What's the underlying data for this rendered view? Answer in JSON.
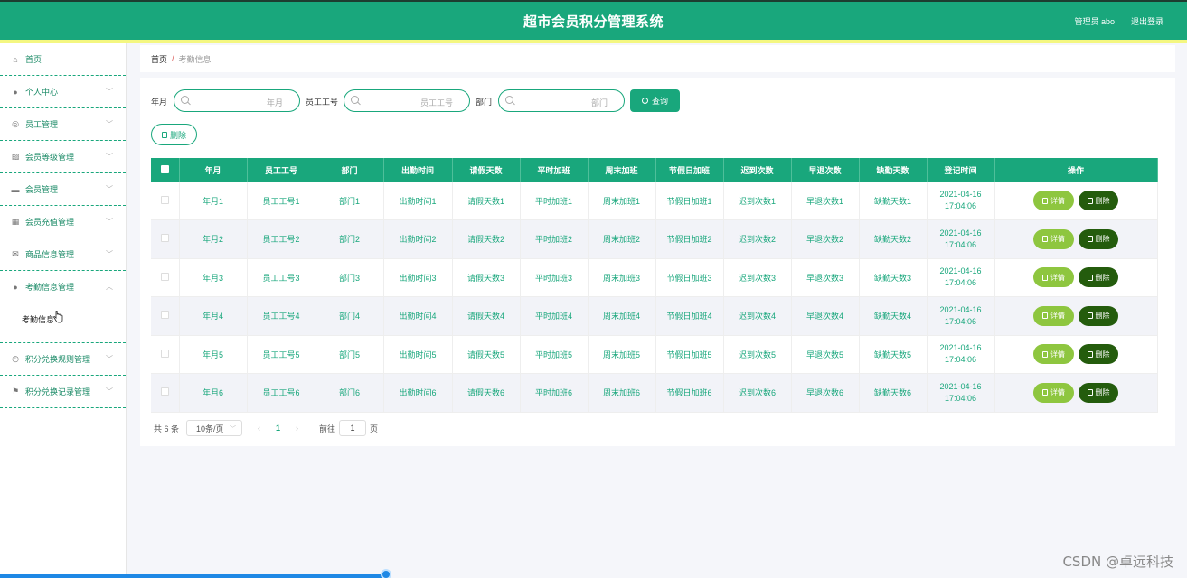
{
  "header": {
    "title": "超市会员积分管理系统",
    "admin": "管理员 abo",
    "logout": "退出登录"
  },
  "sidebar": {
    "items": [
      {
        "label": "首页",
        "icon": "home-icon",
        "chevron": false
      },
      {
        "label": "个人中心",
        "icon": "user-icon",
        "chevron": true
      },
      {
        "label": "员工管理",
        "icon": "circle-icon",
        "chevron": true
      },
      {
        "label": "会员等级管理",
        "icon": "chart-icon",
        "chevron": true
      },
      {
        "label": "会员管理",
        "icon": "chat-icon",
        "chevron": true
      },
      {
        "label": "会员充值管理",
        "icon": "grid-icon",
        "chevron": true
      },
      {
        "label": "商品信息管理",
        "icon": "mail-icon",
        "chevron": true
      },
      {
        "label": "考勤信息管理",
        "icon": "person-icon",
        "chevron": true,
        "expanded": true
      }
    ],
    "sub_item": "考勤信息",
    "items_after": [
      {
        "label": "积分兑换规则管理",
        "icon": "clock-icon",
        "chevron": true
      },
      {
        "label": "积分兑换记录管理",
        "icon": "flag-icon",
        "chevron": true
      }
    ]
  },
  "breadcrumb": {
    "home": "首页",
    "separator": "/",
    "current": "考勤信息"
  },
  "search": {
    "label_1": "年月",
    "placeholder_1": "年月",
    "label_2": "员工工号",
    "placeholder_2": "员工工号",
    "label_3": "部门",
    "placeholder_3": "部门",
    "query": "查询"
  },
  "delete_button": "删除",
  "table": {
    "headers": [
      "年月",
      "员工工号",
      "部门",
      "出勤时间",
      "请假天数",
      "平时加班",
      "周末加班",
      "节假日加班",
      "迟到次数",
      "早退次数",
      "缺勤天数",
      "登记时间",
      "操作"
    ],
    "rows": [
      [
        "年月1",
        "员工工号1",
        "部门1",
        "出勤时间1",
        "请假天数1",
        "平时加班1",
        "周末加班1",
        "节假日加班1",
        "迟到次数1",
        "早退次数1",
        "缺勤天数1",
        "2021-04-16 17:04:06"
      ],
      [
        "年月2",
        "员工工号2",
        "部门2",
        "出勤时间2",
        "请假天数2",
        "平时加班2",
        "周末加班2",
        "节假日加班2",
        "迟到次数2",
        "早退次数2",
        "缺勤天数2",
        "2021-04-16 17:04:06"
      ],
      [
        "年月3",
        "员工工号3",
        "部门3",
        "出勤时间3",
        "请假天数3",
        "平时加班3",
        "周末加班3",
        "节假日加班3",
        "迟到次数3",
        "早退次数3",
        "缺勤天数3",
        "2021-04-16 17:04:06"
      ],
      [
        "年月4",
        "员工工号4",
        "部门4",
        "出勤时间4",
        "请假天数4",
        "平时加班4",
        "周末加班4",
        "节假日加班4",
        "迟到次数4",
        "早退次数4",
        "缺勤天数4",
        "2021-04-16 17:04:06"
      ],
      [
        "年月5",
        "员工工号5",
        "部门5",
        "出勤时间5",
        "请假天数5",
        "平时加班5",
        "周末加班5",
        "节假日加班5",
        "迟到次数5",
        "早退次数5",
        "缺勤天数5",
        "2021-04-16 17:04:06"
      ],
      [
        "年月6",
        "员工工号6",
        "部门6",
        "出勤时间6",
        "请假天数6",
        "平时加班6",
        "周末加班6",
        "节假日加班6",
        "迟到次数6",
        "早退次数6",
        "缺勤天数6",
        "2021-04-16 17:04:06"
      ]
    ],
    "action_detail": "详情",
    "action_delete": "删除"
  },
  "pager": {
    "total": "共 6 条",
    "page_size": "10条/页",
    "current_page": "1",
    "goto_label": "前往",
    "goto_value": "1",
    "page_suffix": "页"
  },
  "watermark": "CSDN @卓远科技",
  "colors": {
    "primary": "#19a77c",
    "accent_yellow": "#f4f781",
    "detail_btn": "#8ec63f",
    "delete_btn": "#245c0d"
  }
}
